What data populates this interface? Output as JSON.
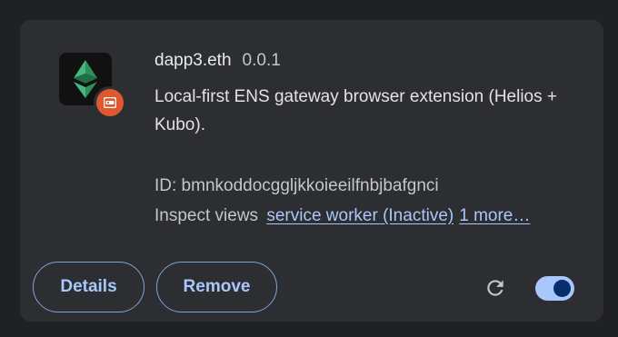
{
  "extension": {
    "name": "dapp3.eth",
    "version": "0.0.1",
    "description": "Local-first ENS gateway browser extension (Helios + Kubo).",
    "id_label": "ID: bmnkoddocggljkkoieeilfnbjbafgnci",
    "inspect_label": "Inspect views",
    "service_worker_link": "service worker (Inactive)",
    "more_link": "1 more…",
    "enabled": true
  },
  "actions": {
    "details_label": "Details",
    "remove_label": "Remove"
  },
  "icons": {
    "extension_logo": "ethereum-classic-logo-icon",
    "badge": "unpacked-extension-badge-icon",
    "reload": "reload-icon"
  },
  "colors": {
    "accent": "#a8c7fa",
    "card_bg": "#2d2e31",
    "badge": "#e0582f",
    "toggle_knob": "#062e6f"
  }
}
